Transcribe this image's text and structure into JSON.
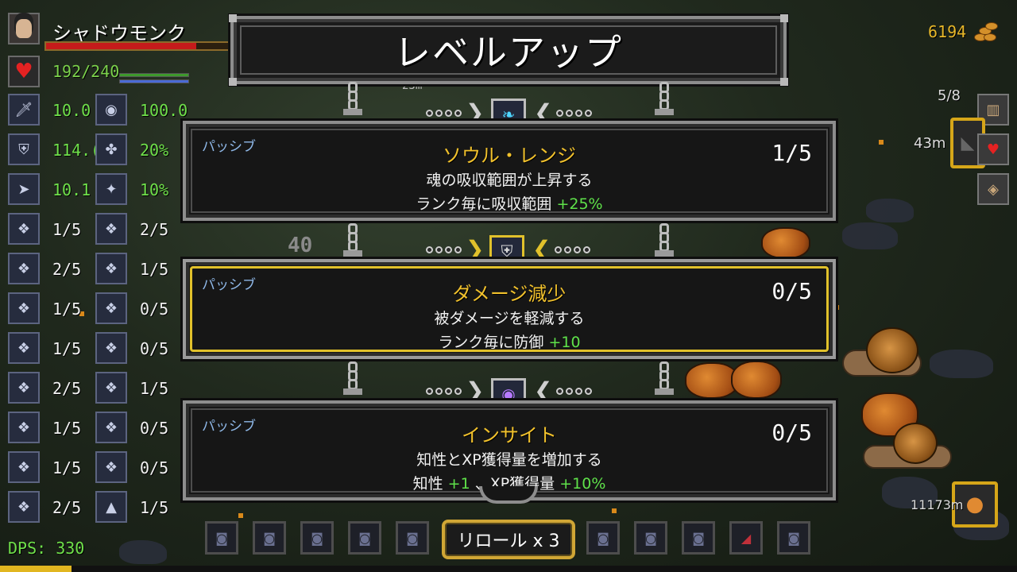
{
  "character": {
    "name": "シャドウモンク",
    "hp": "192/240",
    "hp_fraction": 0.8,
    "portrait_icon": "monk-portrait-icon",
    "heart_icon": "heart-icon"
  },
  "stats": [
    {
      "icon": "dagger-icon",
      "glyph": "🗡",
      "value": "10.0",
      "color": "green"
    },
    {
      "icon": "eye-icon",
      "glyph": "◉",
      "value": "100.0",
      "color": "green"
    },
    {
      "icon": "shield-icon",
      "glyph": "⛨",
      "value": "114.(",
      "color": "green"
    },
    {
      "icon": "clover-icon",
      "glyph": "✤",
      "value": "20%",
      "color": "green"
    },
    {
      "icon": "boot-icon",
      "glyph": "➤",
      "value": "10.1",
      "color": "green"
    },
    {
      "icon": "bag-icon",
      "glyph": "✦",
      "value": "10%",
      "color": "green"
    },
    {
      "icon": "skill-1-icon",
      "glyph": "❖",
      "value": "1/5",
      "color": "white"
    },
    {
      "icon": "skill-2-icon",
      "glyph": "❖",
      "value": "2/5",
      "color": "white"
    },
    {
      "icon": "skill-3-icon",
      "glyph": "❖",
      "value": "2/5",
      "color": "white"
    },
    {
      "icon": "skill-4-icon",
      "glyph": "❖",
      "value": "1/5",
      "color": "white"
    },
    {
      "icon": "skill-5-icon",
      "glyph": "❖",
      "value": "1/5",
      "color": "white"
    },
    {
      "icon": "skill-6-icon",
      "glyph": "❖",
      "value": "0/5",
      "color": "white"
    },
    {
      "icon": "skill-7-icon",
      "glyph": "❖",
      "value": "1/5",
      "color": "white"
    },
    {
      "icon": "skill-8-icon",
      "glyph": "❖",
      "value": "0/5",
      "color": "white"
    },
    {
      "icon": "skill-9-icon",
      "glyph": "❖",
      "value": "2/5",
      "color": "white"
    },
    {
      "icon": "skill-10-icon",
      "glyph": "❖",
      "value": "1/5",
      "color": "white"
    },
    {
      "icon": "skill-11-icon",
      "glyph": "❖",
      "value": "1/5",
      "color": "white"
    },
    {
      "icon": "skill-12-icon",
      "glyph": "❖",
      "value": "0/5",
      "color": "white"
    },
    {
      "icon": "skill-13-icon",
      "glyph": "❖",
      "value": "1/5",
      "color": "white"
    },
    {
      "icon": "skill-14-icon",
      "glyph": "❖",
      "value": "0/5",
      "color": "white"
    },
    {
      "icon": "skill-15-icon",
      "glyph": "❖",
      "value": "2/5",
      "color": "white"
    },
    {
      "icon": "skill-16-icon",
      "glyph": "▲",
      "value": "1/5",
      "color": "white"
    }
  ],
  "dps": "DPS: 330",
  "gold": "6194",
  "slots": "5/8",
  "distance_right": "43m",
  "distance_bottom": "11173m",
  "floating": {
    "a": "40",
    "b": "23m"
  },
  "levelup": {
    "title": "レベルアップ",
    "cards": [
      {
        "type": "パッシブ",
        "name": "ソウル・レンジ",
        "rank": "1/5",
        "desc": "魂の吸収範囲が上昇する",
        "effect_prefix": "ランク毎に吸収範囲 ",
        "effect_value": "+25%",
        "icon": "soul-lantern-icon"
      },
      {
        "type": "パッシブ",
        "name": "ダメージ減少",
        "rank": "0/5",
        "desc": "被ダメージを軽減する",
        "effect_prefix": "ランク毎に防御 ",
        "effect_value": "+10",
        "icon": "shield-icon"
      },
      {
        "type": "パッシブ",
        "name": "インサイト",
        "rank": "0/5",
        "desc": "知性とXP獲得量を増加する",
        "effect_prefix": "知性 ",
        "effect_value": "+1",
        "effect_middle": " 、XP獲得量 ",
        "effect_value2": "+10%",
        "icon": "eye-icon"
      }
    ],
    "reroll": "リロール x 3"
  },
  "colors": {
    "gold": "#e1c12b",
    "green": "#5fe24a",
    "passive_blue": "#8fb8e8",
    "hp_red": "#c51b1b"
  }
}
